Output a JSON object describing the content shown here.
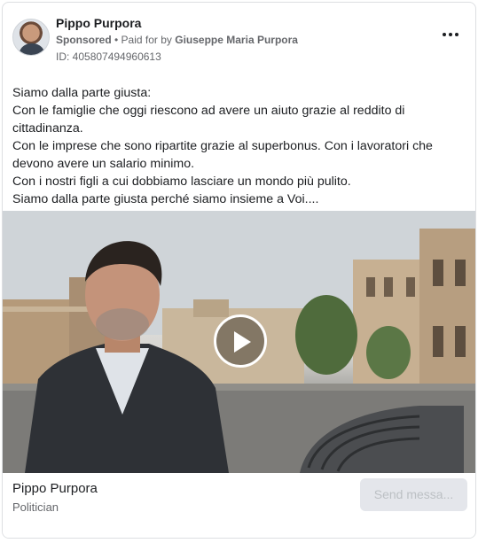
{
  "post": {
    "author_name": "Pippo Purpora",
    "sponsored_label": "Sponsored",
    "separator": " • ",
    "paid_for_prefix": "Paid for by ",
    "payer_name": "Giuseppe Maria Purpora",
    "ad_id": "ID: 405807494960613",
    "more_icon": "more-options-icon",
    "text_lines": [
      "Siamo dalla parte giusta:",
      "Con le famiglie che oggi riescono ad avere un aiuto grazie al reddito di cittadinanza.",
      "Con le imprese che sono ripartite grazie al superbonus. Con i lavoratori che devono avere un salario minimo.",
      "Con i nostri figli a cui dobbiamo lasciare un mondo più pulito.",
      "Siamo dalla parte giusta perché siamo insieme a Voi...."
    ]
  },
  "video": {
    "play_icon": "play-icon"
  },
  "footer": {
    "page_name": "Pippo Purpora",
    "page_category": "Politician",
    "cta_label": "Send messa..."
  },
  "colors": {
    "secondary_text": "#65676b",
    "button_bg": "#e4e6eb",
    "button_text_disabled": "#bcc0c4"
  }
}
